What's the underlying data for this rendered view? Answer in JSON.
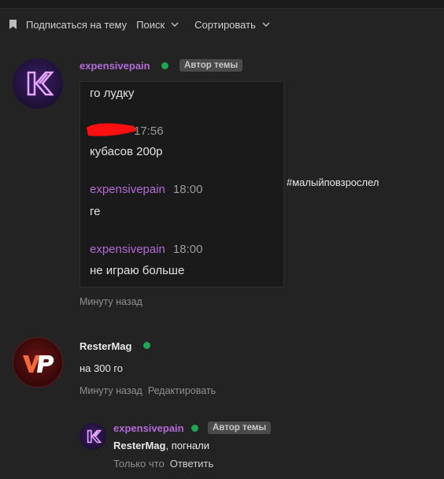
{
  "toolbar": {
    "subscribe_label": "Подписаться на тему",
    "search_label": "Поиск",
    "sort_label": "Сортировать"
  },
  "post1": {
    "username": "expensivepain",
    "badge": "Автор темы",
    "chat": {
      "line1": "го лудку",
      "line2_time": "17:56",
      "line3": "кубасов 200р",
      "msg2_name": "expensivepain",
      "msg2_time": "18:00",
      "msg2_text": "ге",
      "msg3_name": "expensivepain",
      "msg3_time": "18:00",
      "msg3_text": "не играю больше"
    },
    "hashtag": "#малыйповзрослел",
    "time": "Минуту назад"
  },
  "post2": {
    "username": "ResterMag",
    "text": "на 300 го",
    "time": "Минуту назад",
    "edit_label": "Редактировать"
  },
  "reply": {
    "username": "expensivepain",
    "badge": "Автор темы",
    "mention": "ResterMag",
    "text": ", погнали",
    "time": "Только что",
    "reply_label": "Ответить"
  },
  "colors": {
    "username_purple": "#b46ad8",
    "online_green": "#1fa553"
  },
  "icons": [
    "bookmark-icon",
    "chevron-down-icon",
    "online-indicator"
  ]
}
